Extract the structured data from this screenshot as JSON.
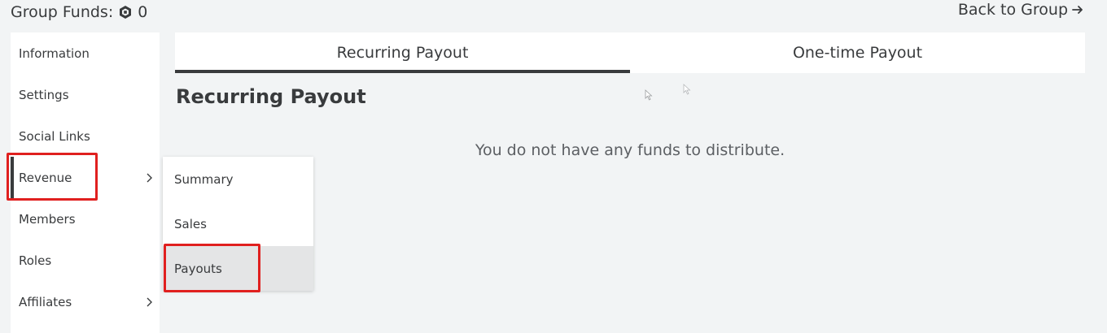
{
  "header": {
    "funds_label": "Group Funds:",
    "funds_amount": "0",
    "back_link": "Back to Group"
  },
  "sidebar": {
    "items": [
      {
        "label": "Information"
      },
      {
        "label": "Settings"
      },
      {
        "label": "Social Links"
      },
      {
        "label": "Revenue",
        "has_submenu": true,
        "active": true
      },
      {
        "label": "Members"
      },
      {
        "label": "Roles"
      },
      {
        "label": "Affiliates",
        "has_submenu": true
      }
    ]
  },
  "submenu": {
    "items": [
      {
        "label": "Summary"
      },
      {
        "label": "Sales"
      },
      {
        "label": "Payouts",
        "selected": true
      }
    ]
  },
  "tabs": [
    {
      "label": "Recurring Payout",
      "active": true
    },
    {
      "label": "One-time Payout"
    }
  ],
  "main": {
    "title": "Recurring Payout",
    "empty_message": "You do not have any funds to distribute."
  },
  "colors": {
    "background": "#f2f4f5",
    "panel": "#ffffff",
    "text": "#393b3d",
    "highlight": "#e0201f",
    "selected_row": "#e4e5e6"
  },
  "icons": [
    "robux-icon",
    "arrow-right-icon",
    "chevron-right-icon",
    "mouse-cursor-icon"
  ]
}
